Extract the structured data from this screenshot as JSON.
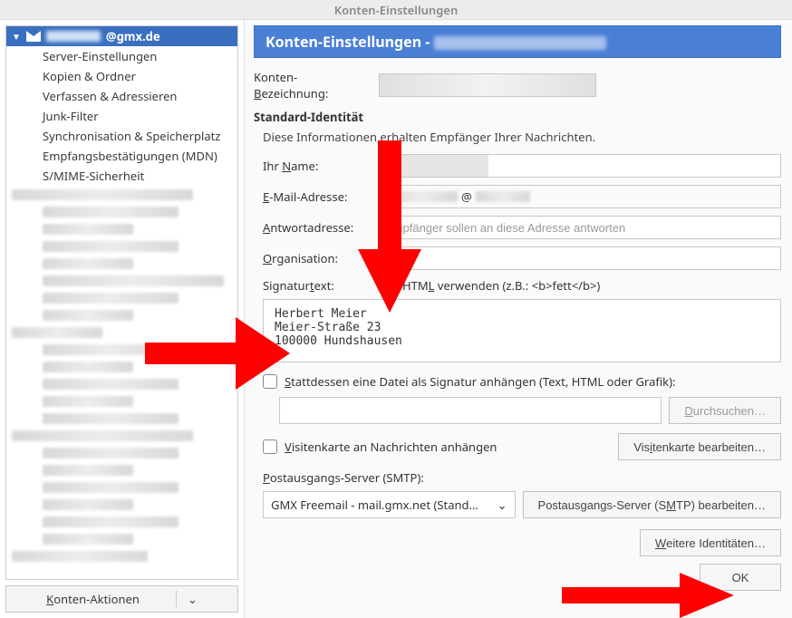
{
  "window_title": "Konten-Einstellungen",
  "sidebar": {
    "account_label": "@gmx.de",
    "items": [
      "Server-Einstellungen",
      "Kopien & Ordner",
      "Verfassen & Adressieren",
      "Junk-Filter",
      "Synchronisation & Speicherplatz",
      "Empfangsbestätigungen (MDN)",
      "S/MIME-Sicherheit"
    ],
    "actions_label": "Konten-Aktionen"
  },
  "content": {
    "banner_prefix": "Konten-Einstellungen - ",
    "acct_name_label": "Konten-Bezeichnung:",
    "identity_heading": "Standard-Identität",
    "identity_sub": "Diese Informationen erhalten Empfänger Ihrer Nachrichten.",
    "name_label": "Ihr Name:",
    "email_label": "E-Mail-Adresse:",
    "email_mid": "@",
    "reply_label": "Antwortadresse:",
    "reply_placeholder": "Empfänger sollen an diese Adresse antworten",
    "org_label": "Organisation:",
    "sig_label": "Signaturtext:",
    "html_checkbox_label": "HTML verwenden (z.B.: <b>fett</b>)",
    "signature_text": "Herbert Meier\nMeier-Straße 23\n100000 Hundshausen",
    "file_checkbox_label": "Stattdessen eine Datei als Signatur anhängen (Text, HTML oder Grafik):",
    "browse_label": "Durchsuchen…",
    "vcard_checkbox_label": "Visitenkarte an Nachrichten anhängen",
    "vcard_edit_label": "Visitenkarte bearbeiten…",
    "smtp_label": "Postausgangs-Server (SMTP):",
    "smtp_value": "GMX Freemail - mail.gmx.net (Stand…",
    "smtp_edit_label": "Postausgangs-Server (SMTP) bearbeiten…",
    "more_identities_label": "Weitere Identitäten…",
    "ok_label": "OK"
  }
}
